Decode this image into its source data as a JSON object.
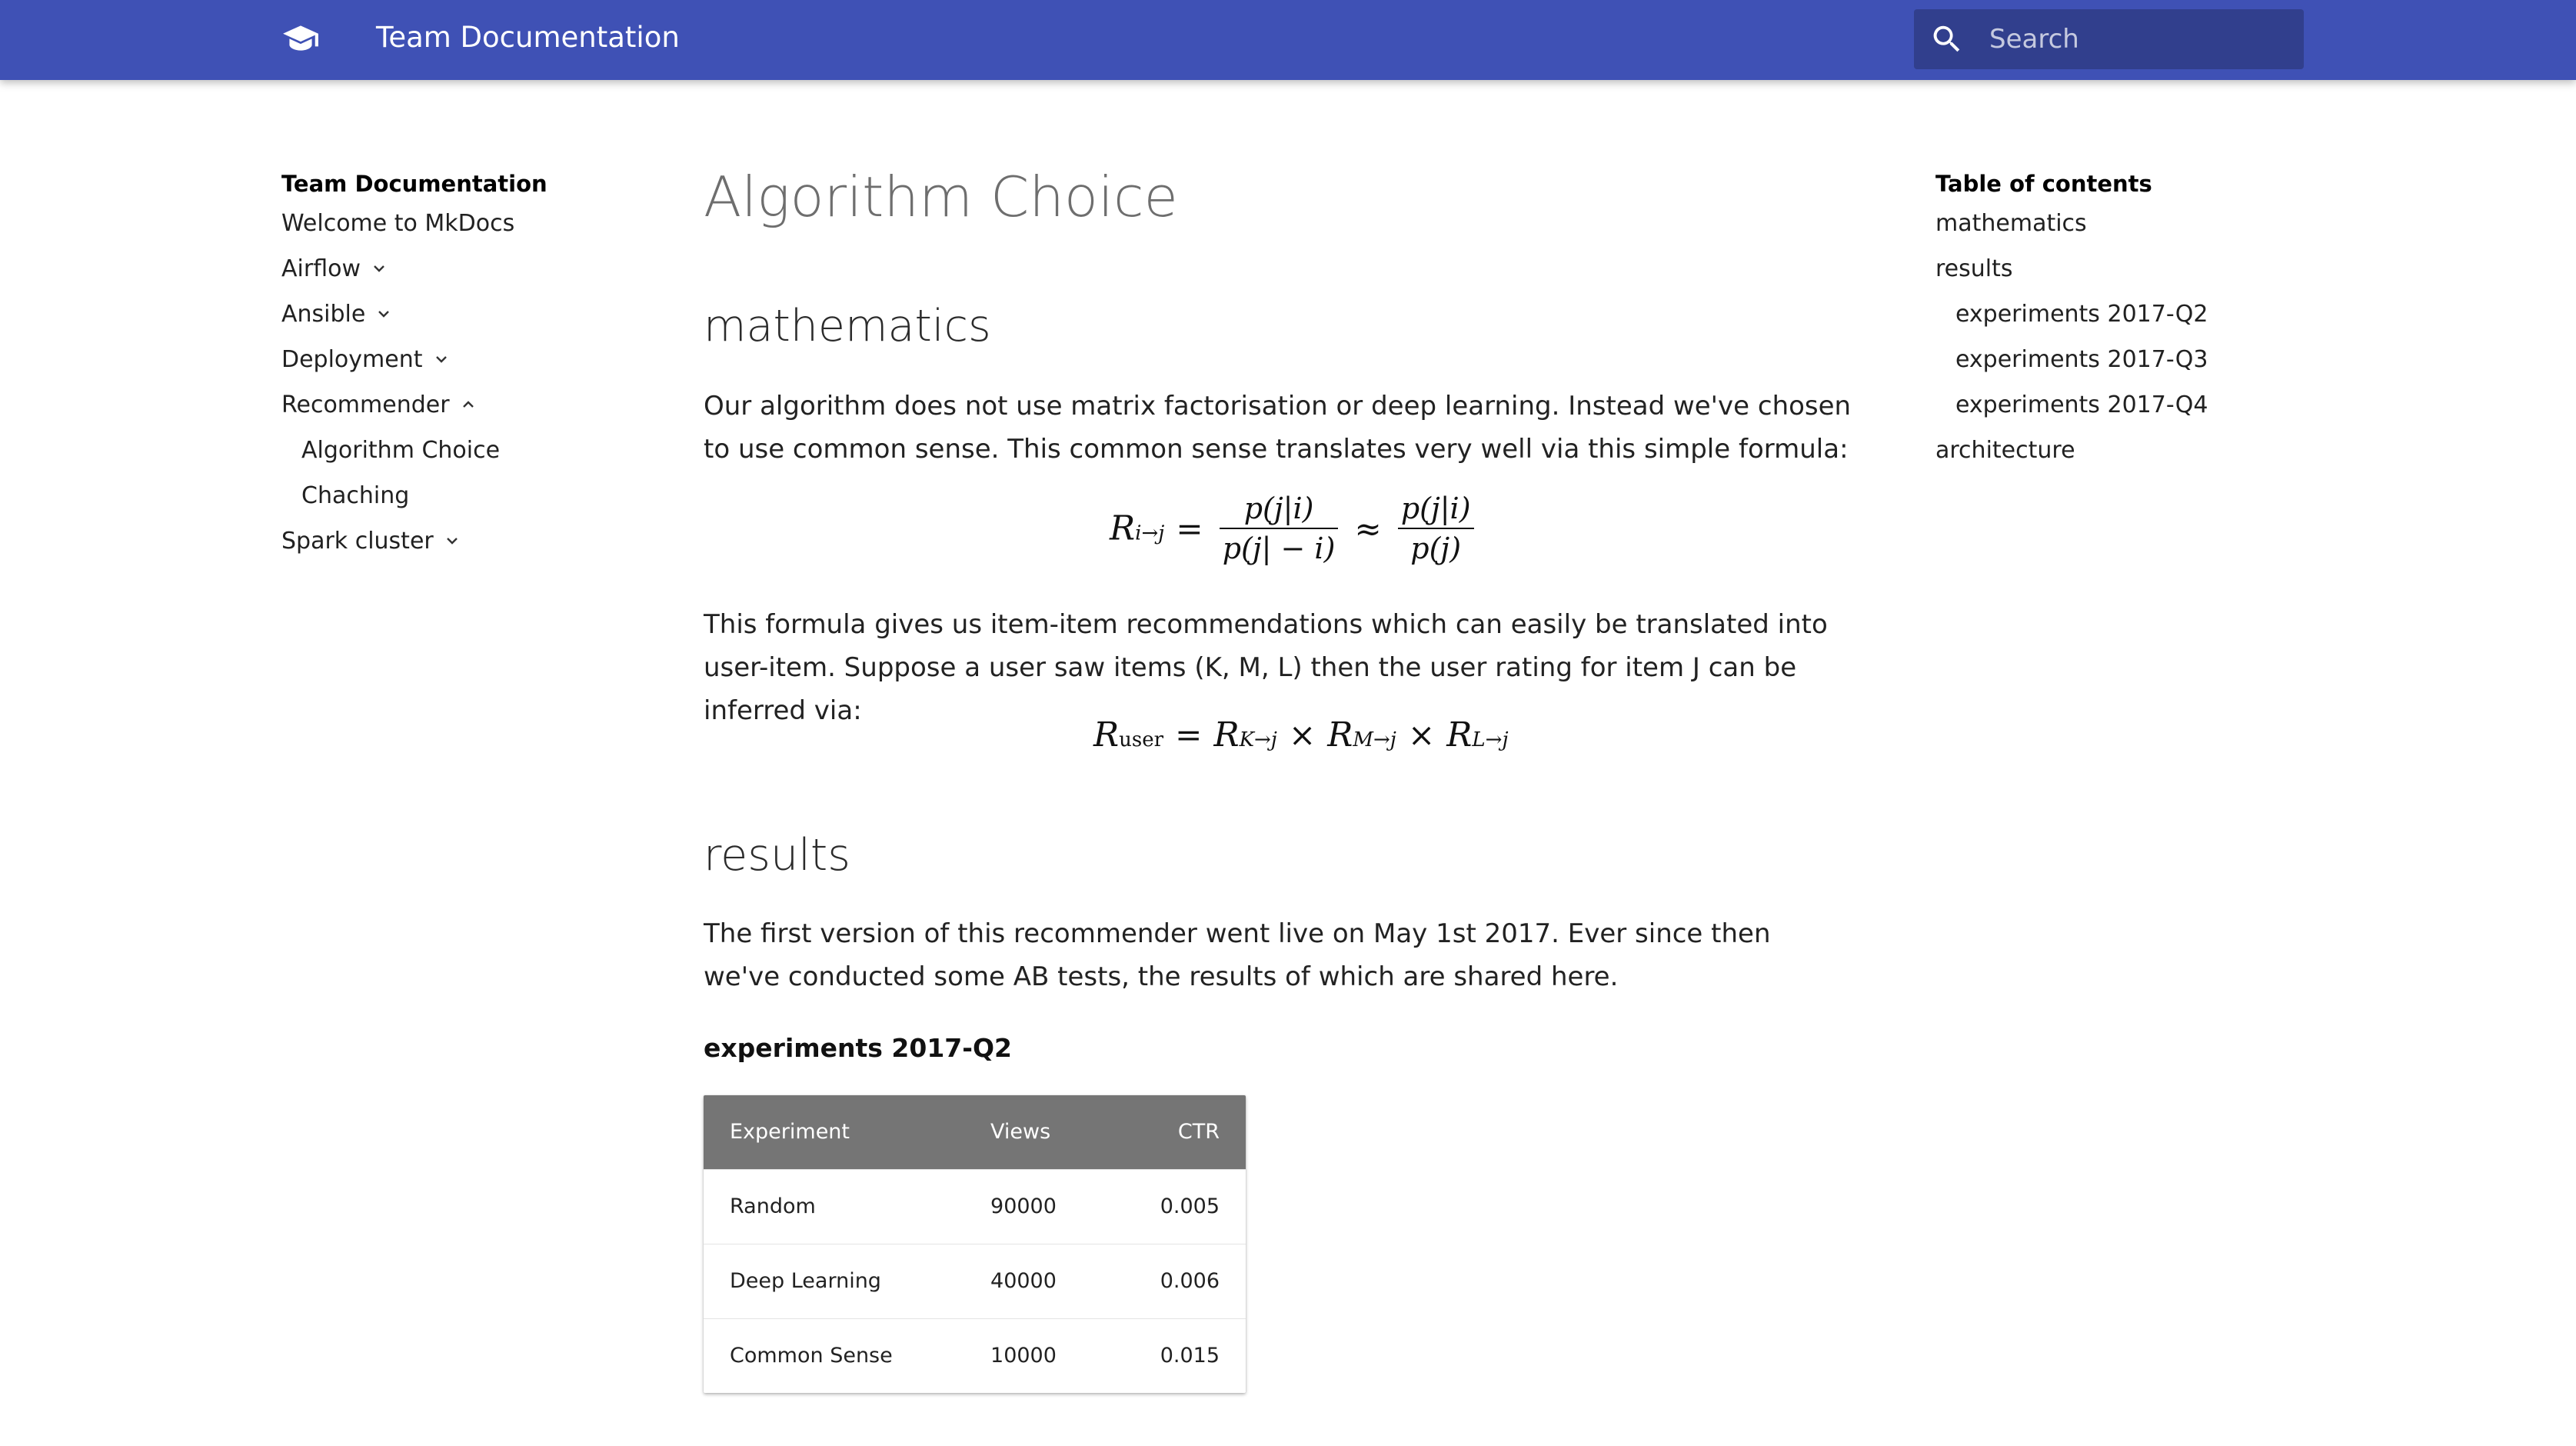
{
  "header": {
    "site_title": "Team Documentation",
    "search_placeholder": "Search",
    "logo_icon": "graduation-cap-icon",
    "search_icon": "search-icon"
  },
  "nav": {
    "title": "Team Documentation",
    "items": [
      {
        "label": "Welcome to MkDocs"
      },
      {
        "label": "Airflow",
        "chevron": "down"
      },
      {
        "label": "Ansible",
        "chevron": "down"
      },
      {
        "label": "Deployment",
        "chevron": "down"
      },
      {
        "label": "Recommender",
        "chevron": "up"
      },
      {
        "label": "Algorithm Choice",
        "sub": true
      },
      {
        "label": "Chaching",
        "sub": true
      },
      {
        "label": "Spark cluster",
        "chevron": "down"
      }
    ]
  },
  "toc": {
    "title": "Table of contents",
    "items": [
      {
        "label": "mathematics"
      },
      {
        "label": "results"
      },
      {
        "label": "experiments 2017-Q2",
        "sub": true
      },
      {
        "label": "experiments 2017-Q3",
        "sub": true
      },
      {
        "label": "experiments 2017-Q4",
        "sub": true
      },
      {
        "label": "architecture"
      }
    ]
  },
  "content": {
    "page_title": "Algorithm Choice",
    "section_math": "mathematics",
    "math_para_1": "Our algorithm does not use matrix factorisation or deep learning. Instead we've chosen to use common sense. This common sense translates very well via this simple formula:",
    "math_para_2": "This formula gives us item-item recommendations which can easily be translated into user-item. Suppose a user saw items (K, M, L) then the user rating for item J can be inferred via:",
    "section_results": "results",
    "results_para": "The first version of this recommender went live on May 1st 2017. Ever since then we've conducted some AB tests, the results of which are shared here.",
    "subsection_q2": "experiments 2017-Q2"
  },
  "formula_1": {
    "lhs": "R",
    "lhs_sub": "i→j",
    "eq": "=",
    "f1_num": "p(j|i)",
    "f1_den": "p(j| − i)",
    "approx": "≈",
    "f2_num": "p(j|i)",
    "f2_den": "p(j)"
  },
  "formula_2": {
    "lhs": "R",
    "lhs_sub": "user",
    "eq": "=",
    "t1": "R",
    "t1_sub": "K→j",
    "times": "×",
    "t2": "R",
    "t2_sub": "M→j",
    "t3": "R",
    "t3_sub": "L→j"
  },
  "table_q2": {
    "headers": [
      "Experiment",
      "Views",
      "CTR"
    ],
    "rows": [
      [
        "Random",
        "90000",
        "0.005"
      ],
      [
        "Deep Learning",
        "40000",
        "0.006"
      ],
      [
        "Common Sense",
        "10000",
        "0.015"
      ]
    ]
  },
  "colors": {
    "header_bg": "#3f51b5",
    "table_header_bg": "#757575"
  }
}
